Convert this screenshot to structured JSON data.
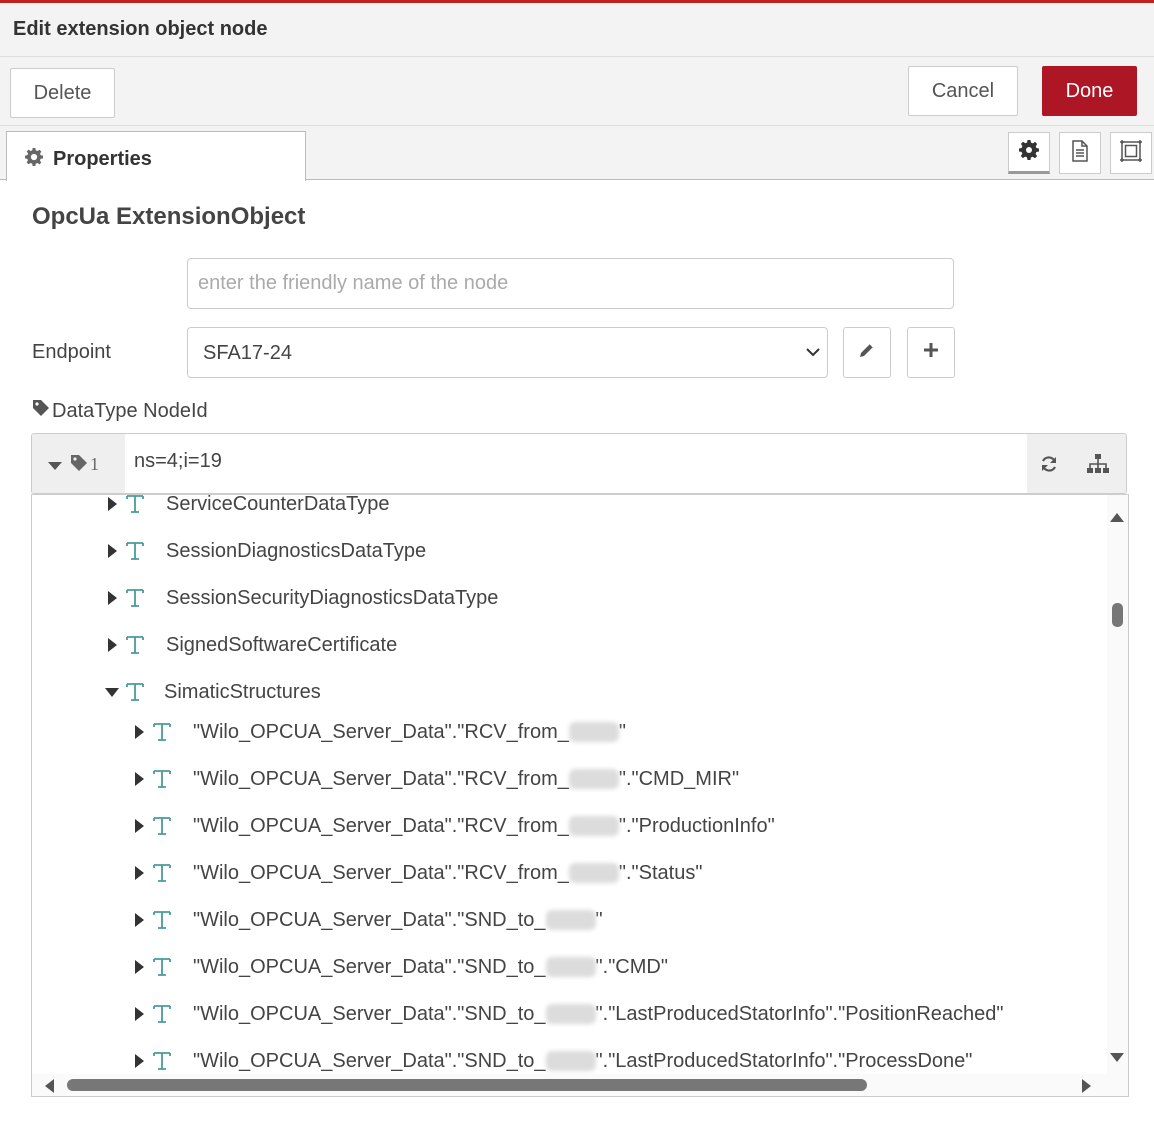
{
  "dialog": {
    "title": "Edit extension object node",
    "delete_label": "Delete",
    "cancel_label": "Cancel",
    "done_label": "Done"
  },
  "tabs": {
    "properties_label": "Properties"
  },
  "form": {
    "heading": "OpcUa ExtensionObject",
    "name_placeholder": "enter the friendly name of the node",
    "name_value": "",
    "endpoint_label": "Endpoint",
    "endpoint_value": "SFA17-24",
    "datatype_label": "DataType NodeId",
    "nodeid_prefix": "1",
    "nodeid_value": "ns=4;i=19"
  },
  "tree": {
    "items": [
      {
        "label": "ServiceCounterDataType"
      },
      {
        "label": "SessionDiagnosticsDataType"
      },
      {
        "label": "SessionSecurityDiagnosticsDataType"
      },
      {
        "label": "SignedSoftwareCertificate"
      },
      {
        "label": "SimaticStructures"
      }
    ],
    "children": [
      {
        "pre": "\"Wilo_OPCUA_Server_Data\".\"RCV_from_",
        "post": "\""
      },
      {
        "pre": "\"Wilo_OPCUA_Server_Data\".\"RCV_from_",
        "post": "\".\"CMD_MIR\""
      },
      {
        "pre": "\"Wilo_OPCUA_Server_Data\".\"RCV_from_",
        "post": "\".\"ProductionInfo\""
      },
      {
        "pre": "\"Wilo_OPCUA_Server_Data\".\"RCV_from_",
        "post": "\".\"Status\""
      },
      {
        "pre": "\"Wilo_OPCUA_Server_Data\".\"SND_to_",
        "post": "\""
      },
      {
        "pre": "\"Wilo_OPCUA_Server_Data\".\"SND_to_",
        "post": "\".\"CMD\""
      },
      {
        "pre": "\"Wilo_OPCUA_Server_Data\".\"SND_to_",
        "post": "\".\"LastProducedStatorInfo\".\"PositionReached\""
      },
      {
        "pre": "\"Wilo_OPCUA_Server_Data\".\"SND_to_",
        "post": "\".\"LastProducedStatorInfo\".\"ProcessDone\""
      }
    ]
  },
  "colors": {
    "done_button": "#ad1625",
    "type_icon": "#4a9b9b"
  },
  "icons": [
    "gear-icon",
    "document-icon",
    "frame-icon",
    "pencil-icon",
    "plus-icon",
    "tag-icon",
    "refresh-icon",
    "sitemap-icon",
    "caret-right-icon",
    "caret-down-icon",
    "type-t-icon"
  ]
}
